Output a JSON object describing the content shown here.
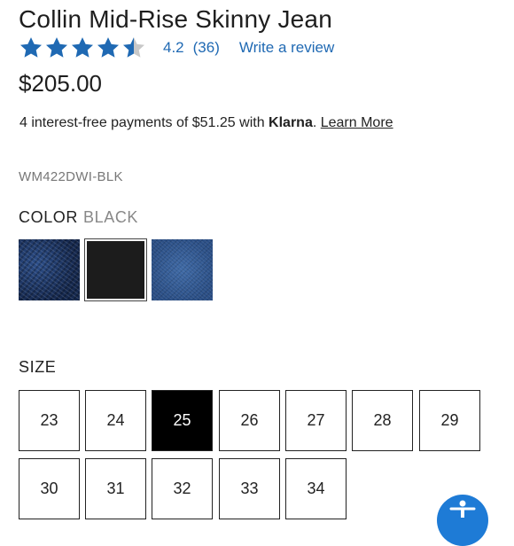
{
  "product": {
    "title": "Collin Mid-Rise Skinny Jean",
    "rating_value": "4.2",
    "review_count": "(36)",
    "write_review_label": "Write a review",
    "price": "$205.00",
    "sku": "WM422DWI-BLK"
  },
  "klarna": {
    "prefix": "4 interest-free payments of $51.25 with ",
    "brand": "Klarna",
    "suffix": ". ",
    "learn_more": "Learn More"
  },
  "color": {
    "label": "COLOR",
    "selected": "BLACK",
    "swatches": [
      "dark-indigo-denim",
      "black",
      "medium-blue-denim"
    ]
  },
  "size": {
    "label": "SIZE",
    "options": [
      "23",
      "24",
      "25",
      "26",
      "27",
      "28",
      "29",
      "30",
      "31",
      "32",
      "33",
      "34"
    ],
    "selected": "25"
  },
  "colors": {
    "link": "#1f69b3",
    "star_filled": "#1f69b3",
    "star_empty": "#c8c8c8",
    "selected_size_bg": "#000000"
  },
  "icons": [
    "star-icon",
    "accessibility-icon"
  ]
}
